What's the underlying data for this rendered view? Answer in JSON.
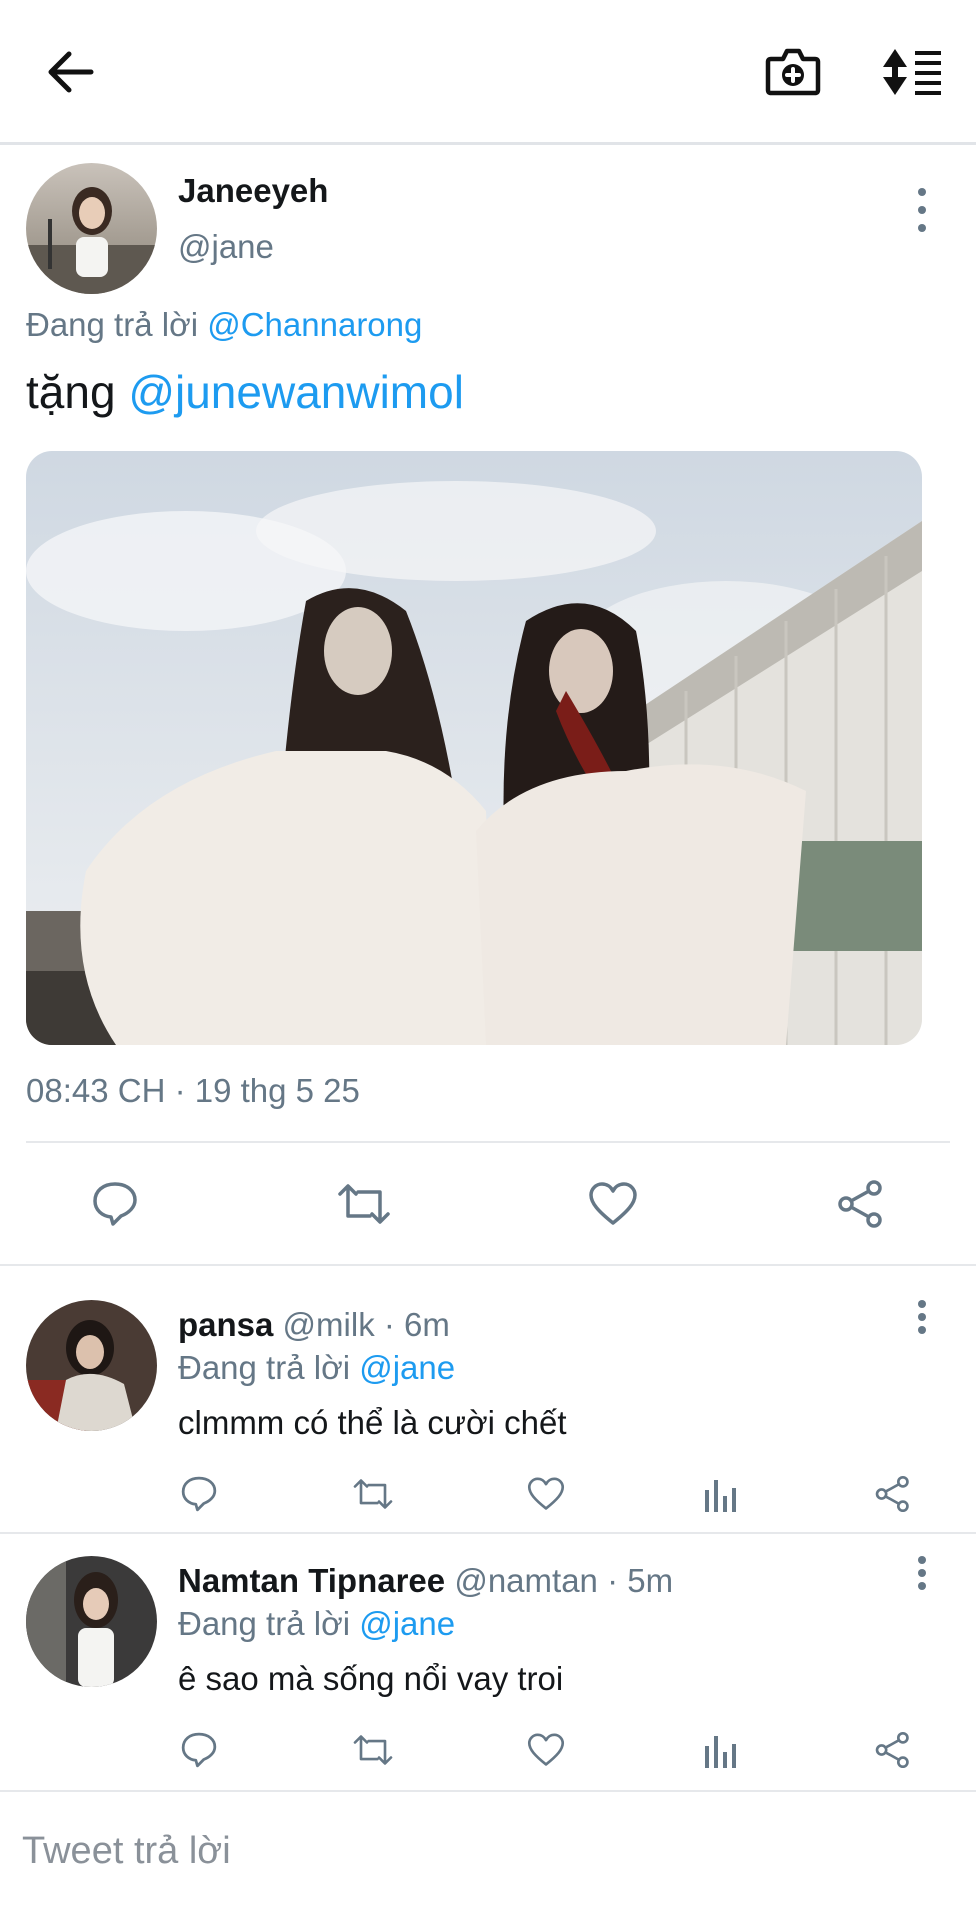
{
  "colors": {
    "accent": "#1d9bf0",
    "text": "#14171a",
    "muted": "#657786",
    "divider": "#e6e8eb"
  },
  "topbar": {
    "back_icon": "back-arrow-icon",
    "camera_icon": "camera-add-icon",
    "sort_icon": "sort-list-icon"
  },
  "tweet": {
    "name": "Janeeyeh",
    "handle": "@jane",
    "replying_prefix": "Đang trả lời",
    "replying_to": "@Channarong",
    "text_prefix": "tặng",
    "text_mention": "@junewanwimol",
    "timestamp": "08:43 CH · 19 thg 5 25",
    "actions": [
      "reply-icon",
      "retweet-icon",
      "like-icon",
      "share-icon"
    ]
  },
  "replies": [
    {
      "name": "pansa",
      "meta": "@milk · 6m",
      "replying_prefix": "Đang trả lời",
      "replying_to": "@jane",
      "text": "clmmm có thể là cười chết"
    },
    {
      "name": "Namtan Tipnaree",
      "meta": "@namtan · 5m",
      "replying_prefix": "Đang trả lời",
      "replying_to": "@jane",
      "text": "ê sao mà sống nổi vay troi"
    }
  ],
  "compose": {
    "placeholder": "Tweet trả lời"
  }
}
